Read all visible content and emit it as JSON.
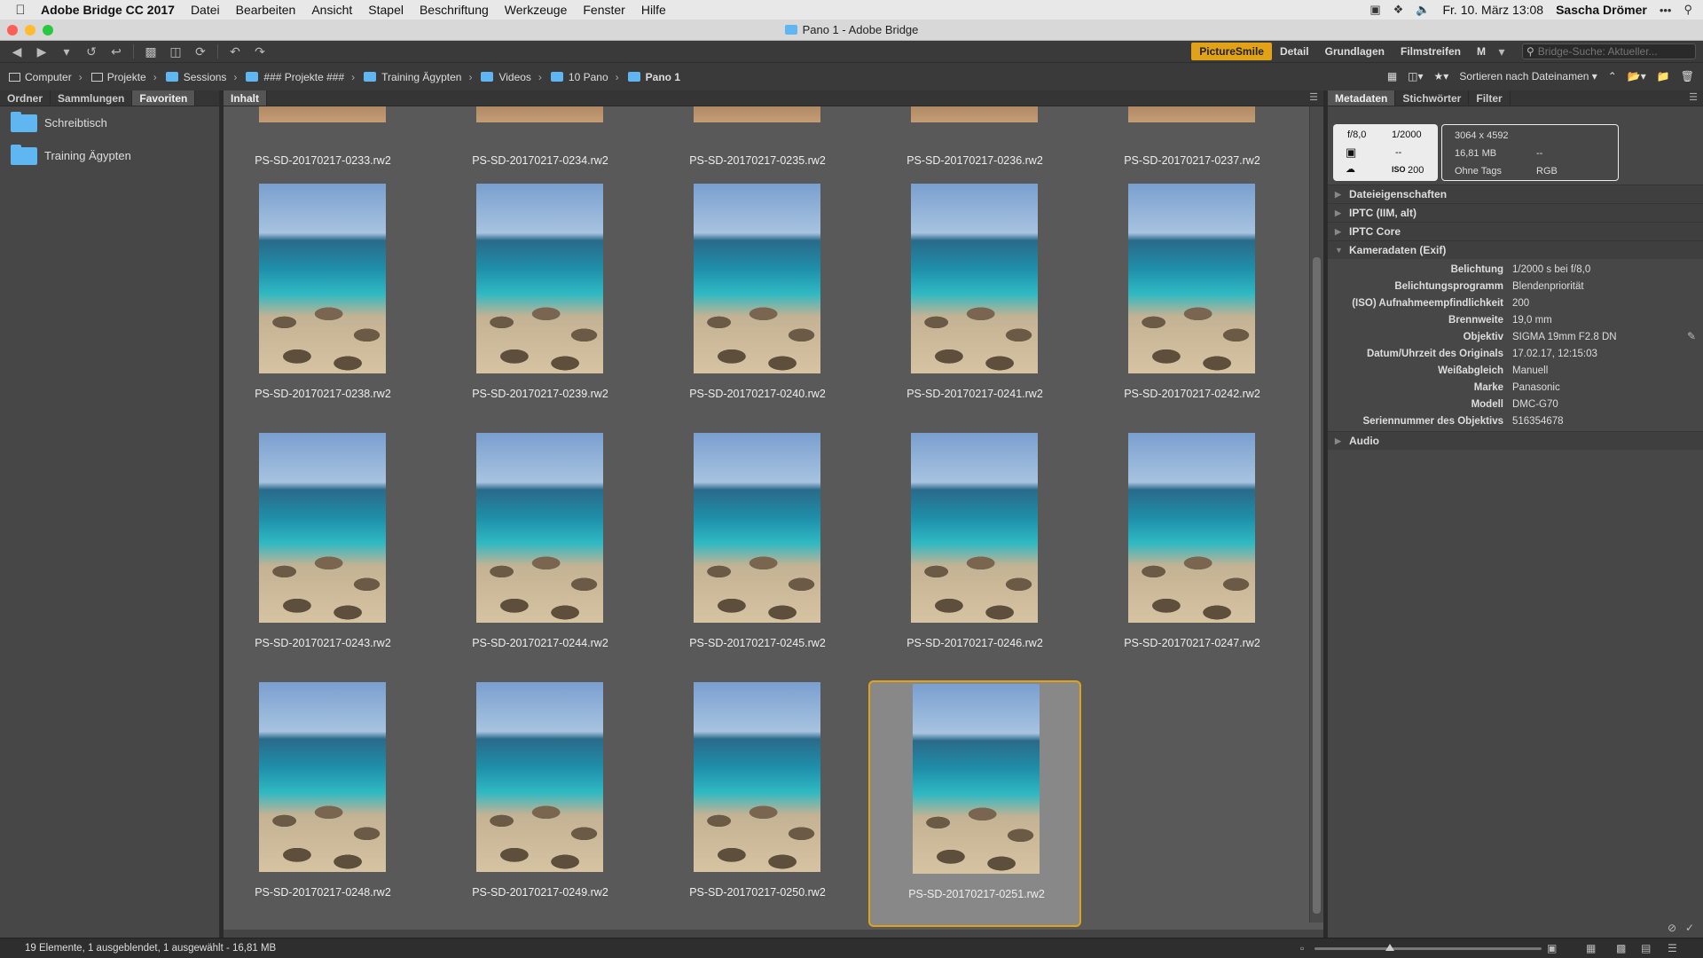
{
  "menubar": {
    "app_name": "Adobe Bridge CC 2017",
    "menus": [
      "Datei",
      "Bearbeiten",
      "Ansicht",
      "Stapel",
      "Beschriftung",
      "Werkzeuge",
      "Fenster",
      "Hilfe"
    ],
    "clock": "Fr. 10. März 13:08",
    "user": "Sascha Drömer"
  },
  "window": {
    "title": "Pano 1 - Adobe Bridge"
  },
  "workspaces": [
    "PictureSmile",
    "Detail",
    "Grundlagen",
    "Filmstreifen",
    "M"
  ],
  "workspace_active": "PictureSmile",
  "search": {
    "placeholder": "Bridge-Suche: Aktueller..."
  },
  "breadcrumbs": [
    "Computer",
    "Projekte",
    "Sessions",
    "### Projekte ###",
    "Training Ägypten",
    "Videos",
    "10 Pano",
    "Pano 1"
  ],
  "sort_label": "Sortieren nach Dateinamen",
  "left_panel": {
    "tabs": [
      "Ordner",
      "Sammlungen",
      "Favoriten"
    ],
    "active_tab": "Favoriten",
    "favorites": [
      "Schreibtisch",
      "Training Ägypten"
    ]
  },
  "content": {
    "tab": "Inhalt",
    "files": [
      "PS-SD-20170217-0233.rw2",
      "PS-SD-20170217-0234.rw2",
      "PS-SD-20170217-0235.rw2",
      "PS-SD-20170217-0236.rw2",
      "PS-SD-20170217-0237.rw2",
      "PS-SD-20170217-0238.rw2",
      "PS-SD-20170217-0239.rw2",
      "PS-SD-20170217-0240.rw2",
      "PS-SD-20170217-0241.rw2",
      "PS-SD-20170217-0242.rw2",
      "PS-SD-20170217-0243.rw2",
      "PS-SD-20170217-0244.rw2",
      "PS-SD-20170217-0245.rw2",
      "PS-SD-20170217-0246.rw2",
      "PS-SD-20170217-0247.rw2",
      "PS-SD-20170217-0248.rw2",
      "PS-SD-20170217-0249.rw2",
      "PS-SD-20170217-0250.rw2",
      "PS-SD-20170217-0251.rw2"
    ],
    "selected_file": "PS-SD-20170217-0251.rw2"
  },
  "right_panel": {
    "tabs": [
      "Metadaten",
      "Stichwörter",
      "Filter"
    ],
    "active_tab": "Metadaten",
    "placard": {
      "aperture": "f/8,0",
      "shutter": "1/2000",
      "iso": "200",
      "dash": "--",
      "dimensions": "3064 x 4592",
      "size": "16,81 MB",
      "size_extra": "--",
      "tags": "Ohne Tags",
      "color_mode": "RGB"
    },
    "sections": [
      "Dateieigenschaften",
      "IPTC (IIM, alt)",
      "IPTC Core",
      "Kameradaten (Exif)",
      "Audio"
    ],
    "exif": [
      {
        "key": "Belichtung",
        "value": "1/2000 s bei f/8,0"
      },
      {
        "key": "Belichtungsprogramm",
        "value": "Blendenpriorität"
      },
      {
        "key": "(ISO) Aufnahmeempfindlichkeit",
        "value": "200"
      },
      {
        "key": "Brennweite",
        "value": "19,0 mm"
      },
      {
        "key": "Objektiv",
        "value": "SIGMA 19mm F2.8 DN"
      },
      {
        "key": "Datum/Uhrzeit des Originals",
        "value": "17.02.17, 12:15:03"
      },
      {
        "key": "Weißabgleich",
        "value": "Manuell"
      },
      {
        "key": "Marke",
        "value": "Panasonic"
      },
      {
        "key": "Modell",
        "value": "DMC-G70"
      },
      {
        "key": "Seriennummer des Objektivs",
        "value": "516354678"
      }
    ]
  },
  "statusbar": {
    "text": "19 Elemente, 1 ausgeblendet, 1 ausgewählt - 16,81 MB"
  },
  "colors": {
    "accent": "#e2a218",
    "folder": "#5fb6f0"
  }
}
